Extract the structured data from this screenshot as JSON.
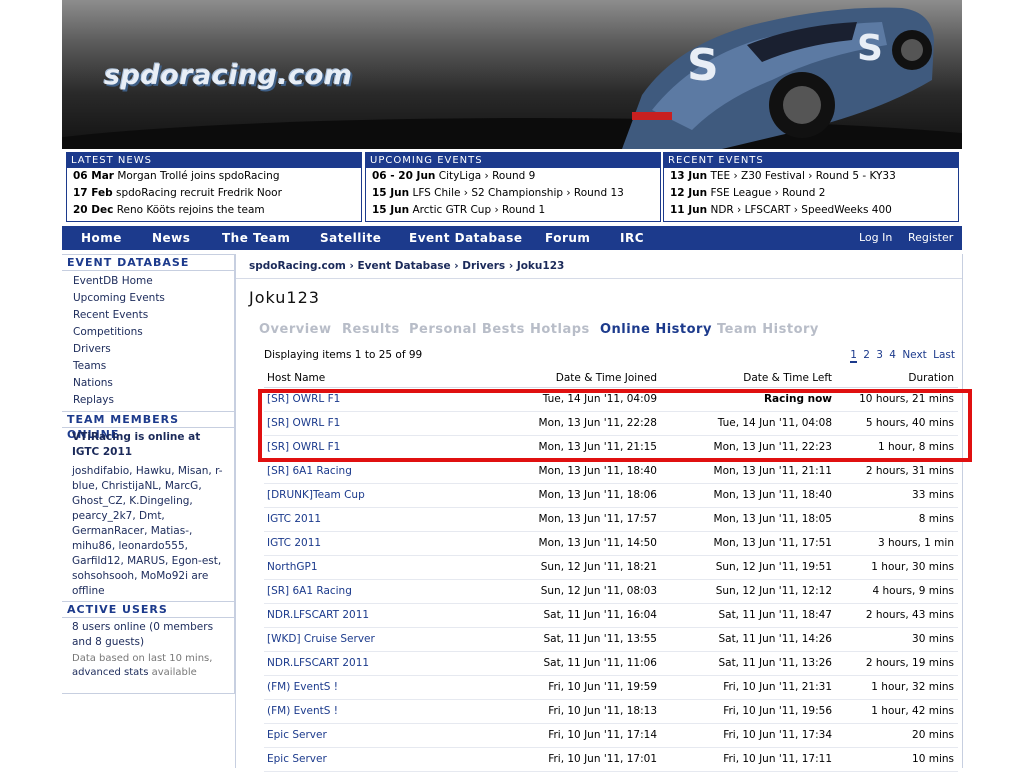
{
  "site": {
    "logo_text": "spdoracing.com"
  },
  "latest_news": {
    "title": "LATEST NEWS",
    "items": [
      {
        "date": "06 Mar",
        "text": "Morgan Trollé joins spdoRacing"
      },
      {
        "date": "17 Feb",
        "text": "spdoRacing recruit Fredrik Noor"
      },
      {
        "date": "20 Dec",
        "text": "Reno Kööts rejoins the team"
      }
    ]
  },
  "upcoming_events": {
    "title": "UPCOMING EVENTS",
    "items": [
      {
        "date": "06 - 20 Jun",
        "text": "CityLiga › Round 9"
      },
      {
        "date": "15 Jun",
        "text": "LFS Chile › S2 Championship › Round 13"
      },
      {
        "date": "15 Jun",
        "text": "Arctic GTR Cup › Round 1"
      }
    ]
  },
  "recent_events": {
    "title": "RECENT EVENTS",
    "items": [
      {
        "date": "13 Jun",
        "text": "TEE › Z30 Festival › Round 5 - KY33"
      },
      {
        "date": "12 Jun",
        "text": "FSE League › Round 2"
      },
      {
        "date": "11 Jun",
        "text": "NDR › LFSCART › SpeedWeeks 400"
      }
    ]
  },
  "nav": {
    "home": "Home",
    "news": "News",
    "team": "The Team",
    "satellite": "Satellite",
    "event_db": "Event Database",
    "forum": "Forum",
    "irc": "IRC",
    "login": "Log In",
    "register": "Register"
  },
  "sidebar": {
    "eventdb_title": "EVENT DATABASE",
    "eventdb_links": [
      "EventDB Home",
      "Upcoming Events",
      "Recent Events",
      "Competitions",
      "Drivers",
      "Teams",
      "Nations",
      "Replays"
    ],
    "team_online_title": "TEAM MEMBERS ONLINE",
    "team_online_status": "VTiRacing is online at IGTC 2011",
    "team_online_list": "joshdifabio, Hawku, Misan, r-blue, ChristijaNL, MarcG, Ghost_CZ, K.Dingeling, pearcy_2k7, Dmt, GermanRacer, Matias-, mihu86, leonardo555, Garfild12, MARUS, Egon-est, sohsohsooh, MoMo92i are offline",
    "active_title": "ACTIVE USERS",
    "active_text": "8 users online (0 members and 8 guests)",
    "active_note": "Data based on last 10 mins,",
    "active_adv": "advanced stats",
    "active_avail": "available"
  },
  "content": {
    "breadcrumb": "spdoRacing.com › Event Database › Drivers › Joku123",
    "title": "Joku123",
    "tabs": {
      "overview": "Overview",
      "results": "Results",
      "personal_bests": "Personal Bests",
      "hotlaps": "Hotlaps",
      "online_history": "Online History",
      "team_history": "Team History"
    },
    "displaying": "Displaying items 1 to 25 of 99",
    "pager": {
      "p1": "1",
      "p2": "2",
      "p3": "3",
      "p4": "4",
      "next": "Next",
      "last": "Last"
    },
    "columns": {
      "host": "Host Name",
      "joined": "Date & Time Joined",
      "left": "Date & Time Left",
      "duration": "Duration"
    },
    "rows": [
      {
        "host": "[SR] OWRL F1",
        "joined": "Tue, 14 Jun '11, 04:09",
        "left": "Racing now",
        "duration": "10 hours, 21 mins"
      },
      {
        "host": "[SR] OWRL F1",
        "joined": "Mon, 13 Jun '11, 22:28",
        "left": "Tue, 14 Jun '11, 04:08",
        "duration": "5 hours, 40 mins"
      },
      {
        "host": "[SR] OWRL F1",
        "joined": "Mon, 13 Jun '11, 21:15",
        "left": "Mon, 13 Jun '11, 22:23",
        "duration": "1 hour, 8 mins"
      },
      {
        "host": "[SR] 6A1 Racing",
        "joined": "Mon, 13 Jun '11, 18:40",
        "left": "Mon, 13 Jun '11, 21:11",
        "duration": "2 hours, 31 mins"
      },
      {
        "host": "[DRUNK]Team Cup",
        "joined": "Mon, 13 Jun '11, 18:06",
        "left": "Mon, 13 Jun '11, 18:40",
        "duration": "33 mins"
      },
      {
        "host": "IGTC 2011",
        "joined": "Mon, 13 Jun '11, 17:57",
        "left": "Mon, 13 Jun '11, 18:05",
        "duration": "8 mins"
      },
      {
        "host": "IGTC 2011",
        "joined": "Mon, 13 Jun '11, 14:50",
        "left": "Mon, 13 Jun '11, 17:51",
        "duration": "3 hours, 1 min"
      },
      {
        "host": "NorthGP1",
        "joined": "Sun, 12 Jun '11, 18:21",
        "left": "Sun, 12 Jun '11, 19:51",
        "duration": "1 hour, 30 mins"
      },
      {
        "host": "[SR] 6A1 Racing",
        "joined": "Sun, 12 Jun '11, 08:03",
        "left": "Sun, 12 Jun '11, 12:12",
        "duration": "4 hours, 9 mins"
      },
      {
        "host": "NDR.LFSCART 2011",
        "joined": "Sat, 11 Jun '11, 16:04",
        "left": "Sat, 11 Jun '11, 18:47",
        "duration": "2 hours, 43 mins"
      },
      {
        "host": "[WKD] Cruise Server",
        "joined": "Sat, 11 Jun '11, 13:55",
        "left": "Sat, 11 Jun '11, 14:26",
        "duration": "30 mins"
      },
      {
        "host": "NDR.LFSCART 2011",
        "joined": "Sat, 11 Jun '11, 11:06",
        "left": "Sat, 11 Jun '11, 13:26",
        "duration": "2 hours, 19 mins"
      },
      {
        "host": "(FM) EventS !",
        "joined": "Fri, 10 Jun '11, 19:59",
        "left": "Fri, 10 Jun '11, 21:31",
        "duration": "1 hour, 32 mins"
      },
      {
        "host": "(FM) EventS !",
        "joined": "Fri, 10 Jun '11, 18:13",
        "left": "Fri, 10 Jun '11, 19:56",
        "duration": "1 hour, 42 mins"
      },
      {
        "host": "Epic Server",
        "joined": "Fri, 10 Jun '11, 17:14",
        "left": "Fri, 10 Jun '11, 17:34",
        "duration": "20 mins"
      },
      {
        "host": "Epic Server",
        "joined": "Fri, 10 Jun '11, 17:01",
        "left": "Fri, 10 Jun '11, 17:11",
        "duration": "10 mins"
      }
    ]
  },
  "colors": {
    "nav_blue": "#1c3a8c",
    "highlight_red": "#e01010",
    "tab_inactive": "#b8bdc8"
  }
}
